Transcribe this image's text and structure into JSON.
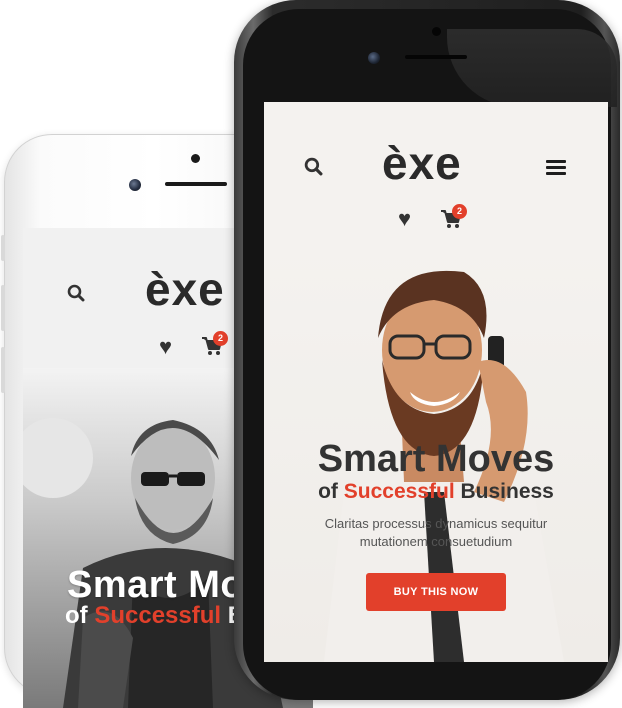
{
  "colors": {
    "accent": "#e2402b",
    "text_dark": "#333333",
    "text_body": "#555555",
    "screen_bg": "#f4f2ef"
  },
  "back_phone": {
    "logo": "èxe",
    "cart_count": "2",
    "headline": "Smart Mo",
    "sub_prefix": "of ",
    "sub_highlight": "Successful",
    "sub_suffix": " B",
    "icons": [
      "search-icon",
      "heart-icon",
      "cart-icon"
    ]
  },
  "front_phone": {
    "logo": "èxe",
    "cart_count": "2",
    "headline": "Smart Moves",
    "sub_prefix": "of ",
    "sub_highlight": "Successful",
    "sub_suffix": " Business",
    "body_line1": "Claritas processus dynamicus sequitur",
    "body_line2": "mutationem consuetudium",
    "cta_label": "BUY THIS NOW",
    "icons": [
      "search-icon",
      "menu-icon",
      "heart-icon",
      "cart-icon"
    ]
  }
}
